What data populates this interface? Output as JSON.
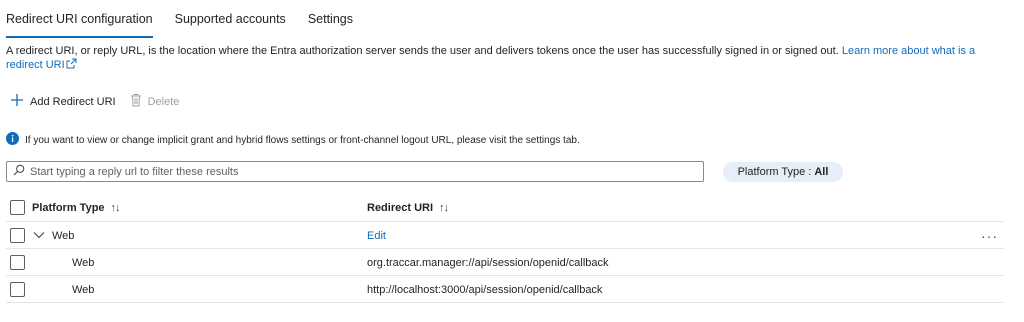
{
  "tabs": [
    {
      "label": "Redirect URI configuration",
      "active": true
    },
    {
      "label": "Supported accounts",
      "active": false
    },
    {
      "label": "Settings",
      "active": false
    }
  ],
  "description": {
    "text": "A redirect URI, or reply URL, is the location where the Entra authorization server sends the user and delivers tokens once the user has successfully signed in or signed out. ",
    "link": "Learn more about what is a redirect URI"
  },
  "toolbar": {
    "add_label": "Add Redirect URI",
    "delete_label": "Delete"
  },
  "info_message": "If you want to view or change implicit grant and hybrid flows settings or front-channel logout URL, please visit the settings tab.",
  "filter": {
    "placeholder": "Start typing a reply url to filter these results",
    "value": ""
  },
  "platform_filter": {
    "label": "Platform Type :",
    "value": "All"
  },
  "table": {
    "columns": {
      "platform_type": "Platform Type",
      "redirect_uri": "Redirect URI",
      "sort_symbol": "↑↓"
    },
    "group": {
      "platform": "Web",
      "action": "Edit",
      "more": "···"
    },
    "rows": [
      {
        "platform": "Web",
        "uri": "org.traccar.manager://api/session/openid/callback"
      },
      {
        "platform": "Web",
        "uri": "http://localhost:3000/api/session/openid/callback"
      }
    ]
  },
  "colors": {
    "accent": "#0f6cbd",
    "pill_bg": "#e6eef8",
    "info_icon": "#0f6cbd"
  },
  "icons": {
    "add": "plus-icon",
    "delete": "trash-icon",
    "info": "info-icon",
    "search": "search-icon",
    "external": "external-link-icon",
    "expand": "chevron-down-icon",
    "more": "more-horizontal-icon"
  }
}
